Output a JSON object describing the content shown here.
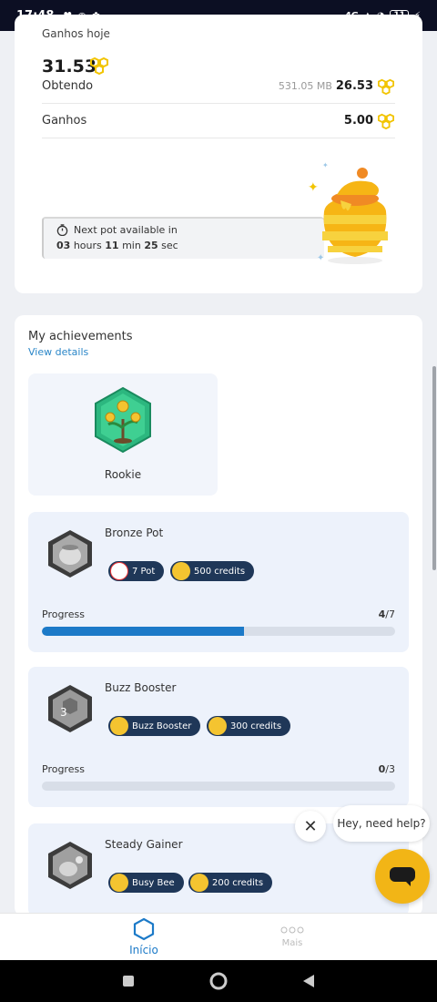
{
  "status_bar": {
    "time": "17:48",
    "network": "4G",
    "battery": "11"
  },
  "earnings": {
    "today_label": "Ganhos hoje",
    "today_value": "31.53",
    "rows": [
      {
        "label": "Obtendo",
        "sub": "531.05 MB",
        "value": "26.53"
      },
      {
        "label": "Ganhos",
        "sub": "",
        "value": "5.00"
      }
    ],
    "next_pot": {
      "label": "Next pot available in",
      "hours": "03",
      "hours_unit": "hours",
      "minutes": "11",
      "minutes_unit": "min",
      "seconds": "25",
      "seconds_unit": "sec"
    }
  },
  "achievements": {
    "title": "My achievements",
    "view_details": "View details",
    "rookie": {
      "label": "Rookie"
    },
    "progress_label": "Progress",
    "items": [
      {
        "name": "Bronze Pot",
        "pill1": "7 Pot",
        "pill2": "500 credits",
        "current": "4",
        "total": "/7",
        "fraction": 0.571
      },
      {
        "name": "Buzz Booster",
        "pill1": "Buzz Booster",
        "pill2": "300 credits",
        "current": "0",
        "total": "/3",
        "fraction": 0
      },
      {
        "name": "Steady Gainer",
        "pill1": "Busy Bee",
        "pill2": "200 credits"
      }
    ]
  },
  "chat": {
    "bubble": "Hey, need help?",
    "close": "✕"
  },
  "bottom_nav": {
    "home": "Início",
    "more": "Mais"
  },
  "colors": {
    "accent": "#1c7ac8",
    "honey": "#f2b516",
    "pill": "#1f3758"
  }
}
